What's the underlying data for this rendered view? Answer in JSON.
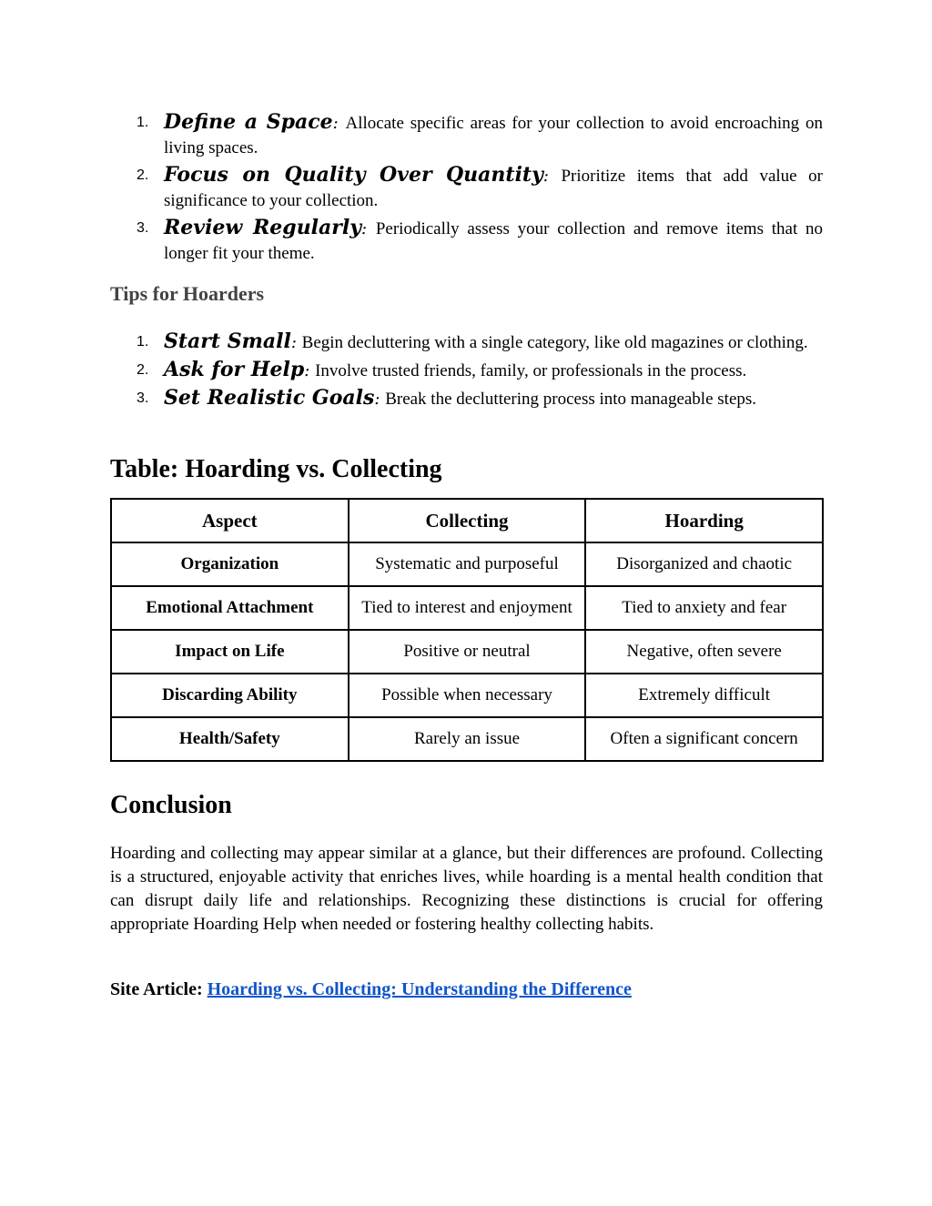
{
  "list_collectors": [
    {
      "number": "1.",
      "term": "Define a Space",
      "description": "Allocate specific areas for your collection to avoid encroaching on living spaces."
    },
    {
      "number": "2.",
      "term": "Focus on Quality Over Quantity",
      "description": "Prioritize items that add value or significance to your collection."
    },
    {
      "number": "3.",
      "term": "Review Regularly",
      "description": "Periodically assess your collection and remove items that no longer fit your theme."
    }
  ],
  "tips_heading": "Tips for Hoarders",
  "list_hoarders": [
    {
      "number": "1.",
      "term": "Start Small",
      "description": "Begin decluttering with a single category, like old magazines or clothing."
    },
    {
      "number": "2.",
      "term": "Ask for Help",
      "description": "Involve trusted friends, family, or professionals in the process."
    },
    {
      "number": "3.",
      "term": "Set Realistic Goals",
      "description": "Break the decluttering process into manageable steps."
    }
  ],
  "table_title": "Table: Hoarding vs. Collecting",
  "table": {
    "headers": [
      "Aspect",
      "Collecting",
      "Hoarding"
    ],
    "rows": [
      [
        "Organization",
        "Systematic and purposeful",
        "Disorganized and chaotic"
      ],
      [
        "Emotional Attachment",
        "Tied to interest and enjoyment",
        "Tied to anxiety and fear"
      ],
      [
        "Impact on Life",
        "Positive or neutral",
        "Negative, often severe"
      ],
      [
        "Discarding Ability",
        "Possible when necessary",
        "Extremely difficult"
      ],
      [
        "Health/Safety",
        "Rarely an issue",
        "Often a significant concern"
      ]
    ]
  },
  "conclusion_heading": "Conclusion",
  "conclusion_text": "Hoarding and collecting may appear similar at a glance, but their differences are profound. Collecting is a structured, enjoyable activity that enriches lives, while hoarding is a mental health condition that can disrupt daily life and relationships. Recognizing these distinctions is crucial for offering appropriate Hoarding Help when needed or fostering healthy collecting habits.",
  "site_article": {
    "label": "Site Article:",
    "link_text": "Hoarding vs. Collecting: Understanding the Difference",
    "link_color": "#1155cc"
  },
  "colors": {
    "text": "#000000",
    "subheading": "#434343"
  }
}
